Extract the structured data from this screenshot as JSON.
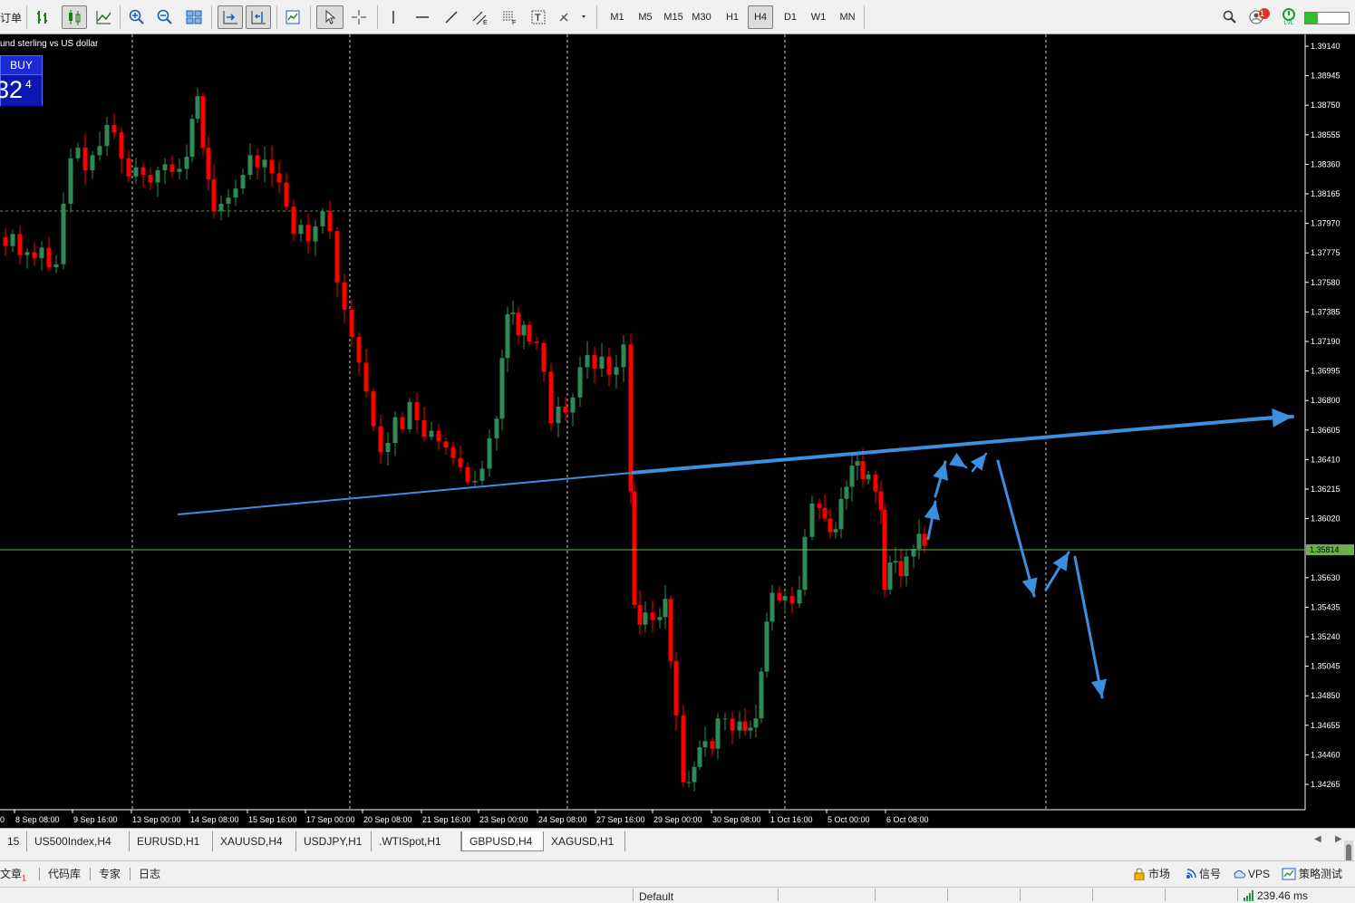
{
  "toolbar": {
    "order_label": "订单",
    "timeframes": [
      "M1",
      "M5",
      "M15",
      "M30",
      "H1",
      "H4",
      "D1",
      "W1",
      "MN"
    ],
    "active_timeframe": "H4",
    "notification_count": "1",
    "level_label": "LVL"
  },
  "chart": {
    "symbol_description": "und sterling  vs US dollar",
    "buy_label": "BUY",
    "buy_price_big": "32",
    "buy_price_small": "4",
    "current_price": "1.35814",
    "colors": {
      "background": "#000000",
      "bull": "#2e8b57",
      "bear": "#ff0000",
      "grid": "#c8c8c8",
      "bid_line": "#6ab04c",
      "annotation": "#3b8fe0"
    },
    "price_ticks": [
      "1.39140",
      "1.38945",
      "1.38750",
      "1.38555",
      "1.38360",
      "1.38165",
      "1.37970",
      "1.37775",
      "1.37580",
      "1.37385",
      "1.37190",
      "1.36995",
      "1.36800",
      "1.36605",
      "1.36410",
      "1.36215",
      "1.36020",
      "1.35630",
      "1.35435",
      "1.35240",
      "1.35045",
      "1.34850",
      "1.34655",
      "1.34460",
      "1.34265"
    ],
    "time_ticks": [
      "8 Sep 08:00",
      "9 Sep 16:00",
      "13 Sep 00:00",
      "14 Sep 08:00",
      "15 Sep 16:00",
      "17 Sep 00:00",
      "20 Sep 08:00",
      "21 Sep 16:00",
      "23 Sep 00:00",
      "24 Sep 08:00",
      "27 Sep 16:00",
      "29 Sep 00:00",
      "30 Sep 08:00",
      "1 Oct 16:00",
      "5 Oct 00:00",
      "6 Oct 08:00"
    ],
    "time_tick_edge": "0"
  },
  "tabs": {
    "items": [
      "15",
      "US500Index,H4",
      "EURUSD,H1",
      "XAUUSD,H4",
      "USDJPY,H1",
      ".WTISpot,H1",
      "GBPUSD,H4",
      "XAGUSD,H1"
    ],
    "active": "GBPUSD,H4"
  },
  "toolbox": {
    "articles_label": "文章",
    "articles_badge": "1",
    "codebase_label": "代码库",
    "experts_label": "专家",
    "journal_label": "日志",
    "market_label": "市场",
    "signals_label": "信号",
    "vps_label": "VPS",
    "tester_label": "策略测试"
  },
  "status": {
    "profile": "Default",
    "ping": "239.46 ms"
  }
}
